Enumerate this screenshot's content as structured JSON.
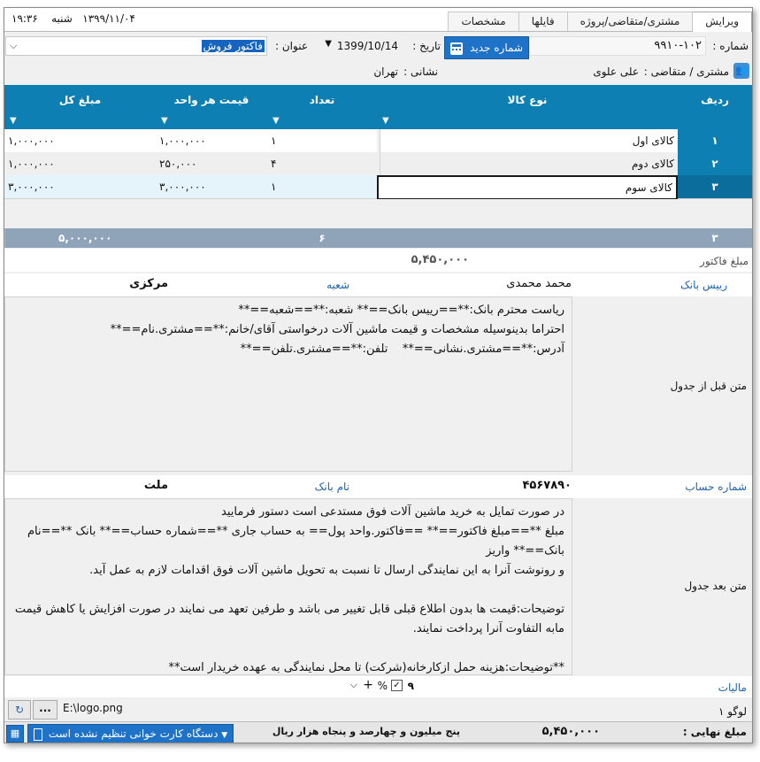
{
  "tabs": [
    {
      "label": "ویرایش",
      "active": true
    },
    {
      "label": "مشتری/متقاضی/پروژه",
      "active": false
    },
    {
      "label": "فایلها",
      "active": false
    },
    {
      "label": "مشخصات",
      "active": false
    }
  ],
  "clock": {
    "time": "۱۹:۳۶",
    "weekday": "شنبه",
    "date": "۱۳۹۹/۱۱/۰۴"
  },
  "header": {
    "number_label": "شماره :",
    "number_value": "۹۹۱۰-۱۰۲",
    "new_number_button": "شماره جدید",
    "date_label": "تاریخ :",
    "date_value": "1399/10/14",
    "title_label": "عنوان :",
    "title_value": "فاکتور فروش",
    "customer_label": "مشتری / متقاضی :",
    "customer_value": "علی علوی",
    "address_label": "نشانی :",
    "address_value": "تهران"
  },
  "grid": {
    "columns": [
      "ردیف",
      "نوع کالا",
      "تعداد",
      "قیمت هر واحد",
      "مبلغ کل"
    ],
    "rows": [
      {
        "no": "۱",
        "item": "کالای اول",
        "qty": "۱",
        "price": "۱,۰۰۰,۰۰۰",
        "total": "۱,۰۰۰,۰۰۰"
      },
      {
        "no": "۲",
        "item": "کالای دوم",
        "qty": "۴",
        "price": "۲۵۰,۰۰۰",
        "total": "۱,۰۰۰,۰۰۰"
      },
      {
        "no": "۳",
        "item": "کالای سوم",
        "qty": "۱",
        "price": "۳,۰۰۰,۰۰۰",
        "total": "۳,۰۰۰,۰۰۰"
      }
    ],
    "footer": {
      "count": "۳",
      "qty": "۶",
      "total": "۵,۰۰۰,۰۰۰"
    }
  },
  "invoice_amount_label": "مبلغ فاکتور",
  "invoice_amount_value": "۵,۴۵۰,۰۰۰",
  "bank_head": {
    "label": "رییس بانک",
    "name": "محمد محمدی",
    "branch_label": "شعبه",
    "branch_value": "مرکزی"
  },
  "before_table": {
    "label": "متن قبل از جدول",
    "text": "ریاست محترم بانک:**==رییس بانک==** شعبه:**==شعبه==**\nاحتراما بدینوسیله مشخصات و قیمت ماشین آلات درخواستی آقای/خانم:**==مشتری.نام==**\nآدرس:**==مشتری.نشانی==**    تلفن:**==مشتری.تلفن==**"
  },
  "account": {
    "label": "شماره حساب",
    "value": "۴۵۶۷۸۹۰",
    "bank_label": "نام بانک",
    "bank_value": "ملت"
  },
  "after_table": {
    "label": "متن بعد جدول",
    "text": "در صورت تمایل به خرید ماشین آلات فوق مستدعی است دستور فرمایید\nمبلغ **==مبلغ فاکتور==** ==فاکتور.واحد پول== به حساب جاری **==شماره حساب==** بانک **==نام بانک==** واریز\nو رونوشت آنرا به این نمایندگی ارسال تا نسبت به تحویل ماشین آلات فوق اقدامات لازم به عمل آید.\n\nتوضیحات:قیمت ها بدون اطلاع قبلی قابل تغییر می باشد و طرفین تعهد می نمایند در صورت افزایش یا کاهش قیمت\nمابه التفاوت آنرا پرداخت نمایند.\n\n**توضیحات:هزینه حمل ازکارخانه(شرکت) تا محل نمایندگی به عهده خریدار است**"
  },
  "tax": {
    "label": "مالیات",
    "value": "۹",
    "percent": "%"
  },
  "logo": {
    "label": "لوگو ۱",
    "path": "E:\\logo.png",
    "browse": "..."
  },
  "status": {
    "device_text": "دستگاه کارت خوانی تنظیم نشده است",
    "final_label": "مبلغ نهایی :",
    "final_value": "۵,۴۵۰,۰۰۰",
    "final_words": "پنج میلیون و چهارصد و پنجاه  هزار  ریال"
  }
}
